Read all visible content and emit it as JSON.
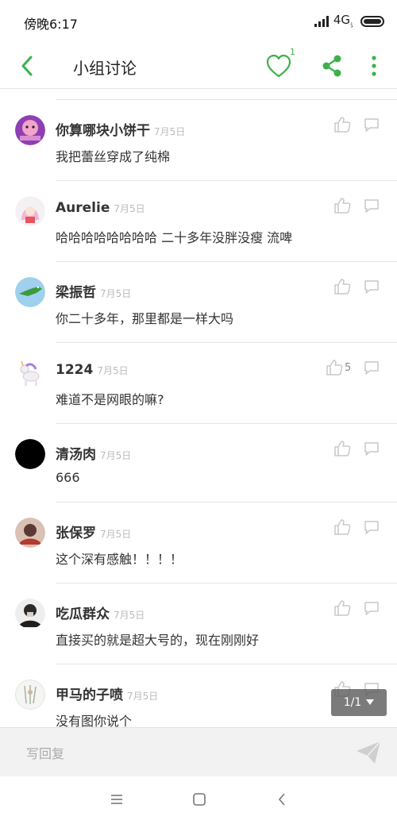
{
  "status_bar": {
    "time": "傍晚6:17",
    "network": "4G",
    "network_suffix": "讠"
  },
  "header": {
    "title": "小组讨论",
    "favorite_count": "1"
  },
  "comments": [
    {
      "name": "你算哪块小饼干",
      "date": "7月5日",
      "text": "我把蕾丝穿成了纯棉",
      "likes": ""
    },
    {
      "name": "Aurelie",
      "date": "7月5日",
      "text": "哈哈哈哈哈哈哈哈 二十多年没胖没瘦 流啤",
      "likes": ""
    },
    {
      "name": "梁振哲",
      "date": "7月5日",
      "text": "你二十多年，那里都是一样大吗",
      "likes": ""
    },
    {
      "name": "1224",
      "date": "7月5日",
      "text": "难道不是网眼的嘛?",
      "likes": "5"
    },
    {
      "name": "清汤肉",
      "date": "7月5日",
      "text": "666",
      "likes": ""
    },
    {
      "name": "张保罗",
      "date": "7月5日",
      "text": "这个深有感触！！！！",
      "likes": ""
    },
    {
      "name": "吃瓜群众",
      "date": "7月5日",
      "text": "直接买的就是超大号的，现在刚刚好",
      "likes": ""
    },
    {
      "name": "甲马的子喷",
      "date": "7月5日",
      "text": "没有图你说个",
      "likes": ""
    }
  ],
  "pager": {
    "label": "1/1"
  },
  "reply": {
    "placeholder": "写回复"
  },
  "colors": {
    "accent": "#3cb14a",
    "icon_gray": "#c8c8c8",
    "divider": "#e6e6e6"
  }
}
